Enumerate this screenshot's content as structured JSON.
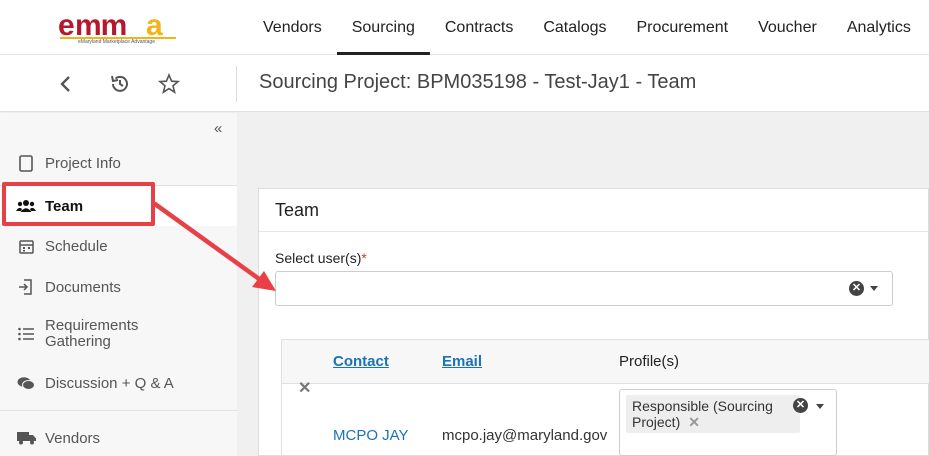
{
  "logo": {
    "text": "emma",
    "tagline": "eMaryland Marketplace Advantage"
  },
  "nav": {
    "items": [
      "Vendors",
      "Sourcing",
      "Contracts",
      "Catalogs",
      "Procurement",
      "Voucher",
      "Analytics"
    ],
    "active": "Sourcing"
  },
  "titlebar": {
    "title": "Sourcing Project: BPM035198 - Test-Jay1 - Team",
    "icons": [
      "back-icon",
      "history-icon",
      "star-icon"
    ]
  },
  "sidebar": {
    "collapse_icon": "double-chevron-left-icon",
    "items": [
      {
        "label": "Project Info",
        "icon": "document-icon"
      },
      {
        "label": "Team",
        "icon": "users-icon",
        "active": true
      },
      {
        "label": "Schedule",
        "icon": "calendar-icon"
      },
      {
        "label": "Documents",
        "icon": "file-import-icon"
      },
      {
        "label": "Requirements Gathering",
        "icon": "list-icon"
      },
      {
        "label": "Discussion + Q & A",
        "icon": "comments-icon"
      },
      {
        "label": "Vendors",
        "icon": "truck-icon"
      }
    ]
  },
  "card": {
    "title": "Team",
    "select_label": "Select user(s)",
    "required_mark": "*",
    "select_value": ""
  },
  "table": {
    "headers": {
      "contact": "Contact",
      "email": "Email",
      "profiles": "Profile(s)"
    },
    "rows": [
      {
        "contact": "MCPO JAY",
        "email": "mcpo.jay@maryland.gov",
        "profile_tag": "Responsible (Sourcing Project)"
      }
    ]
  },
  "colors": {
    "accent_link": "#1a73b8",
    "annotation": "#e84047",
    "logo_red": "#b5172e",
    "logo_gold": "#f2b418"
  }
}
